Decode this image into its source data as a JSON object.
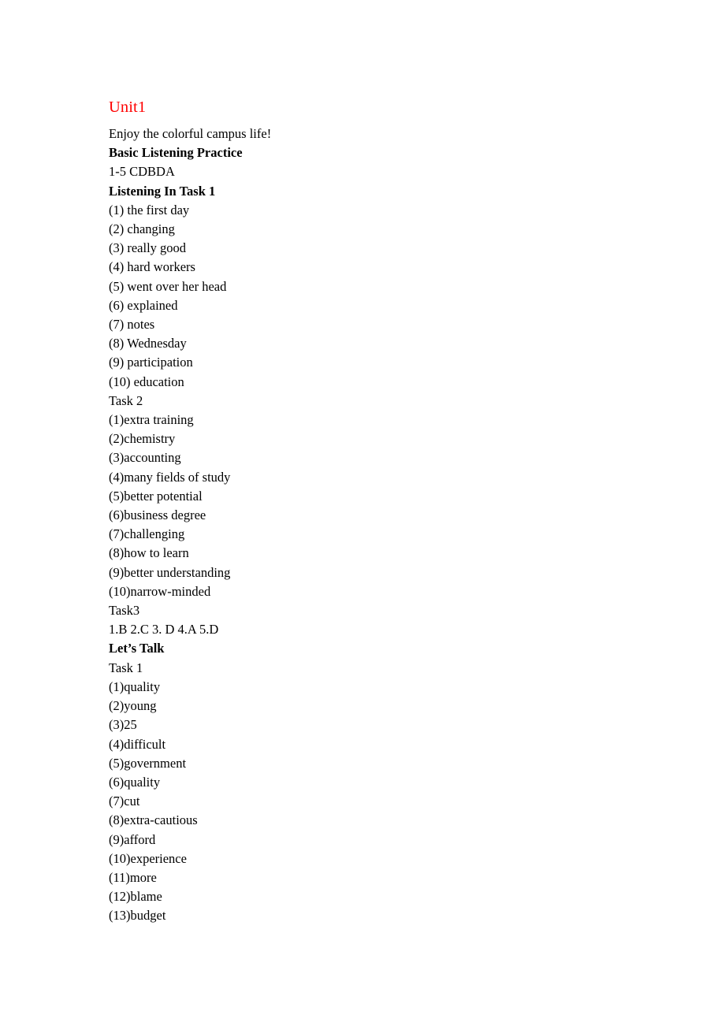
{
  "document": {
    "title": "Unit1",
    "title_color": "#FF0000",
    "body_color": "#000000",
    "page_background": "#FFFFFF",
    "lines": [
      {
        "text": "Enjoy the colorful campus life!",
        "bold": false
      },
      {
        "text": "Basic Listening Practice",
        "bold": true
      },
      {
        "text": "1-5 CDBDA",
        "bold": false
      },
      {
        "text": "Listening In Task 1",
        "bold": true
      },
      {
        "text": "(1) the first day",
        "bold": false
      },
      {
        "text": "(2) changing",
        "bold": false
      },
      {
        "text": "(3) really good",
        "bold": false
      },
      {
        "text": "(4) hard workers",
        "bold": false
      },
      {
        "text": "(5) went over her head",
        "bold": false
      },
      {
        "text": "(6) explained",
        "bold": false
      },
      {
        "text": "(7) notes",
        "bold": false
      },
      {
        "text": "(8) Wednesday",
        "bold": false
      },
      {
        "text": "(9) participation",
        "bold": false
      },
      {
        "text": "(10) education",
        "bold": false
      },
      {
        "text": "Task 2",
        "bold": false
      },
      {
        "text": "(1)extra training",
        "bold": false
      },
      {
        "text": "(2)chemistry",
        "bold": false
      },
      {
        "text": "(3)accounting",
        "bold": false
      },
      {
        "text": "(4)many fields of study",
        "bold": false
      },
      {
        "text": "(5)better potential",
        "bold": false
      },
      {
        "text": "(6)business degree",
        "bold": false
      },
      {
        "text": "(7)challenging",
        "bold": false
      },
      {
        "text": "(8)how to learn",
        "bold": false
      },
      {
        "text": "(9)better understanding",
        "bold": false
      },
      {
        "text": "(10)narrow-minded",
        "bold": false
      },
      {
        "text": "Task3",
        "bold": false
      },
      {
        "text": "1.B 2.C 3. D 4.A 5.D",
        "bold": false
      },
      {
        "text": "Let’s Talk",
        "bold": true
      },
      {
        "text": "Task 1",
        "bold": false
      },
      {
        "text": "(1)quality",
        "bold": false
      },
      {
        "text": "(2)young",
        "bold": false
      },
      {
        "text": "(3)25",
        "bold": false
      },
      {
        "text": "(4)difficult",
        "bold": false
      },
      {
        "text": "(5)government",
        "bold": false
      },
      {
        "text": "(6)quality",
        "bold": false
      },
      {
        "text": "(7)cut",
        "bold": false
      },
      {
        "text": "(8)extra-cautious",
        "bold": false
      },
      {
        "text": "(9)afford",
        "bold": false
      },
      {
        "text": "(10)experience",
        "bold": false
      },
      {
        "text": "(11)more",
        "bold": false
      },
      {
        "text": "(12)blame",
        "bold": false
      },
      {
        "text": "(13)budget",
        "bold": false
      }
    ]
  }
}
